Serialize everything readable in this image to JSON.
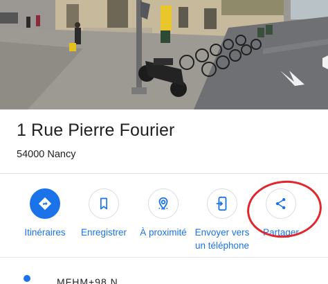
{
  "place": {
    "title": "1 Rue Pierre Fourier",
    "address": "54000 Nancy"
  },
  "actions": [
    {
      "label": "Itinéraires",
      "icon": "directions-icon"
    },
    {
      "label": "Enregistrer",
      "icon": "bookmark-icon"
    },
    {
      "label": "À proximité",
      "icon": "nearby-icon"
    },
    {
      "label_line1": "Envoyer vers",
      "label_line2": "un téléphone",
      "icon": "send-to-phone-icon"
    },
    {
      "label": "Partager",
      "icon": "share-icon"
    }
  ],
  "bottom": {
    "text": "MFHM+98 N"
  },
  "colors": {
    "accent": "#1a73e8",
    "highlight": "#e2262b",
    "divider": "#e3e3e3"
  }
}
